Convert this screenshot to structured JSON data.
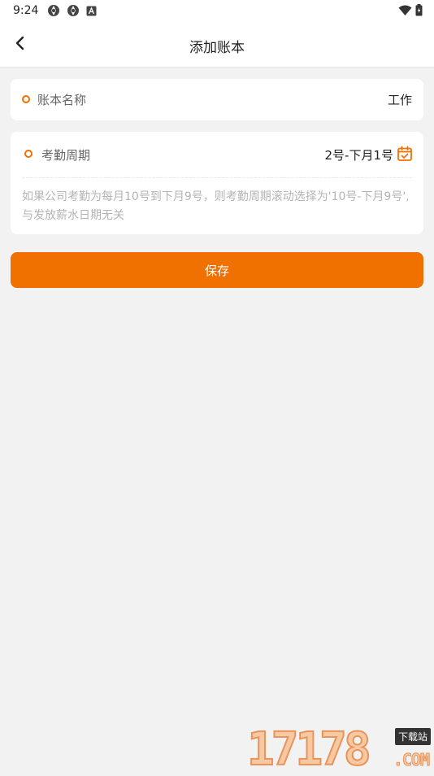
{
  "status_bar": {
    "time": "9:24",
    "icons_left": [
      "aperture-icon",
      "aperture-icon",
      "a-box-icon"
    ],
    "icons_right": [
      "wifi-icon",
      "battery-icon"
    ]
  },
  "header": {
    "title": "添加账本",
    "back_icon": "chevron-left-icon"
  },
  "form": {
    "name_field": {
      "label": "账本名称",
      "value": "工作"
    },
    "period_field": {
      "label": "考勤周期",
      "value": "2号-下月1号",
      "icon": "calendar-check-icon",
      "hint": "如果公司考勤为每月10号到下月9号，则考勤周期滚动选择为'10号-下月9号',与发放薪水日期无关"
    }
  },
  "actions": {
    "save_label": "保存"
  },
  "watermark": {
    "digits": "17178",
    "badge": "下载站",
    "com": ".COM"
  },
  "colors": {
    "accent": "#f07000",
    "background": "#f2f2f2",
    "card": "#ffffff",
    "hint": "#b4b4b4"
  }
}
